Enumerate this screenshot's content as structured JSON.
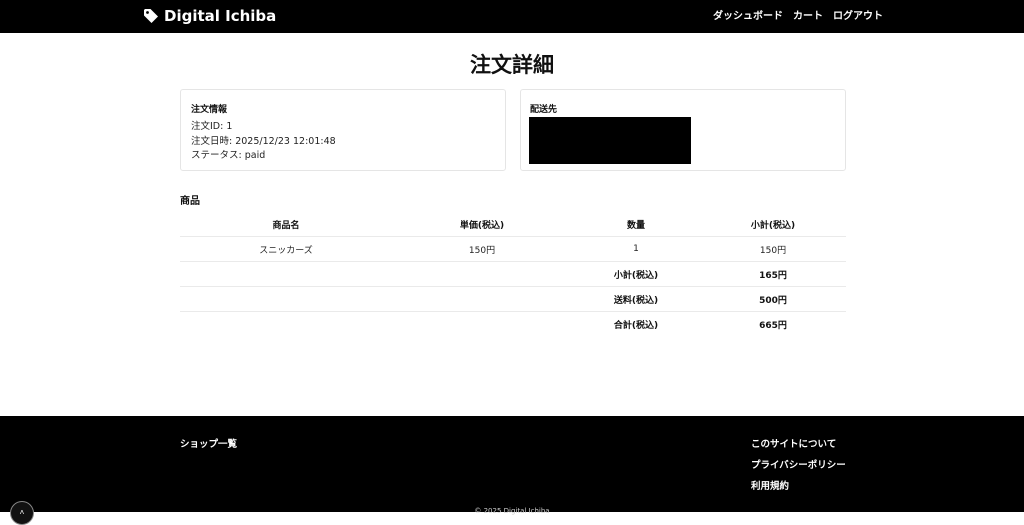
{
  "navbar": {
    "brand": "Digital Ichiba",
    "brand_icon": "tag-icon",
    "links": [
      "ダッシュボード",
      "カート",
      "ログアウト"
    ]
  },
  "page": {
    "title": "注文詳細"
  },
  "order_info": {
    "title": "注文情報",
    "lines": [
      "注文ID: 1",
      "注文日時: 2025/12/23 12:01:48",
      "ステータス: paid"
    ]
  },
  "shipping": {
    "title": "配送先"
  },
  "items": {
    "title": "商品",
    "headers": [
      "商品名",
      "単価(税込)",
      "数量",
      "小計(税込)"
    ],
    "rows": [
      {
        "name": "スニッカーズ",
        "price": "150円",
        "qty": "1",
        "subtotal": "150円"
      }
    ],
    "summary": [
      {
        "label": "小計(税込)",
        "value": "165円"
      },
      {
        "label": "送料(税込)",
        "value": "500円"
      },
      {
        "label": "合計(税込)",
        "value": "665円"
      }
    ]
  },
  "footer": {
    "left_link": "ショップ一覧",
    "right_links": [
      "このサイトについて",
      "プライバシーポリシー",
      "利用規約"
    ],
    "copyright": "© 2025 Digital Ichiba"
  },
  "colors": {
    "header_bg": "#000000",
    "footer_bg": "#000000",
    "background": "#ffffff"
  }
}
